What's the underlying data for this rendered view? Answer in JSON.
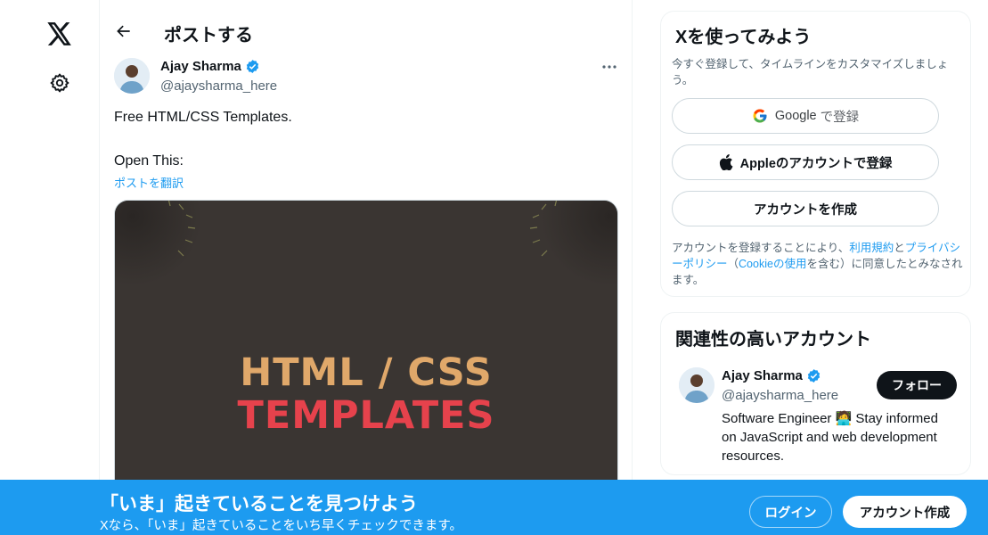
{
  "page": {
    "title": "ポストする",
    "accent_color": "#1d9bf0"
  },
  "nav": {
    "logo_icon": "x-logo-icon",
    "settings_icon": "gear-icon"
  },
  "post": {
    "author": {
      "name": "Ajay Sharma",
      "handle": "@ajaysharma_here",
      "verified": true
    },
    "text_line1": "Free HTML/CSS Templates.",
    "text_line2": "Open This:",
    "translate_label": "ポストを翻訳",
    "media": {
      "line1": "HTML / CSS",
      "line2": "TEMPLATES",
      "background_color": "#3a3532",
      "line1_color": "#e0a86a",
      "line2_color": "#e6424c"
    }
  },
  "signup": {
    "title": "Xを使ってみよう",
    "subtitle": "今すぐ登録して、タイムラインをカスタマイズしましょう。",
    "google_label": "Google",
    "google_suffix": "で登録",
    "apple_label": "Appleのアカウントで登録",
    "create_label": "アカウントを作成",
    "terms": {
      "prefix": "アカウントを登録することにより、",
      "terms_link": "利用規約",
      "and": "と",
      "privacy_link": "プライバシーポリシー",
      "paren_open": "（",
      "cookie_link": "Cookieの使用",
      "suffix": "を含む）に同意したとみなされます。"
    }
  },
  "related": {
    "title": "関連性の高いアカウント",
    "account": {
      "name": "Ajay Sharma",
      "handle": "@ajaysharma_here",
      "verified": true,
      "follow_label": "フォロー",
      "bio": "Software Engineer 🧑‍💻 Stay informed on JavaScript and web development resources."
    }
  },
  "banner": {
    "title": "「いま」起きていることを見つけよう",
    "subtitle": "Xなら、「いま」起きていることをいち早くチェックできます。",
    "login_label": "ログイン",
    "create_label": "アカウント作成"
  }
}
